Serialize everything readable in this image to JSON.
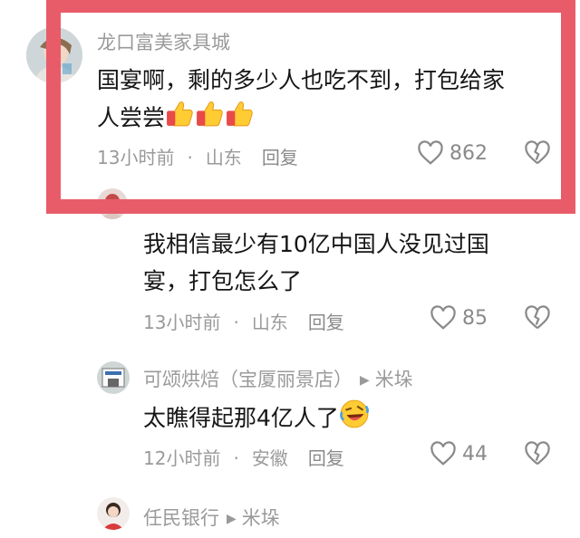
{
  "comments": [
    {
      "username": "龙口富美家具城",
      "text": "国宴啊，剩的多少人也吃不到，打包给家人尝尝",
      "text_line1": "国宴啊，剩的多少人也吃不到，打包给家",
      "text_line2": "人尝尝",
      "emoji": "thumbs-up-icon",
      "emoji_count": 3,
      "time": "13小时前",
      "location": "山东",
      "reply_label": "回复",
      "likes": "862"
    },
    {
      "username": "",
      "text_line1": "我相信最少有10亿中国人没见过国",
      "text_line2": "宴，打包怎么了",
      "time": "13小时前",
      "location": "山东",
      "reply_label": "回复",
      "likes": "85"
    },
    {
      "username": "可颂烘焙（宝厦丽景店）",
      "reply_to": "米垛",
      "text": "太瞧得起那4亿人了",
      "emoji": "rolling-laughing-icon",
      "time": "12小时前",
      "location": "安徽",
      "reply_label": "回复",
      "likes": "44"
    },
    {
      "username": "任民银行",
      "reply_to": "米垛"
    }
  ],
  "colors": {
    "highlight": "#e85c6a",
    "meta_text": "#9a9a9a",
    "body_text": "#161616"
  }
}
